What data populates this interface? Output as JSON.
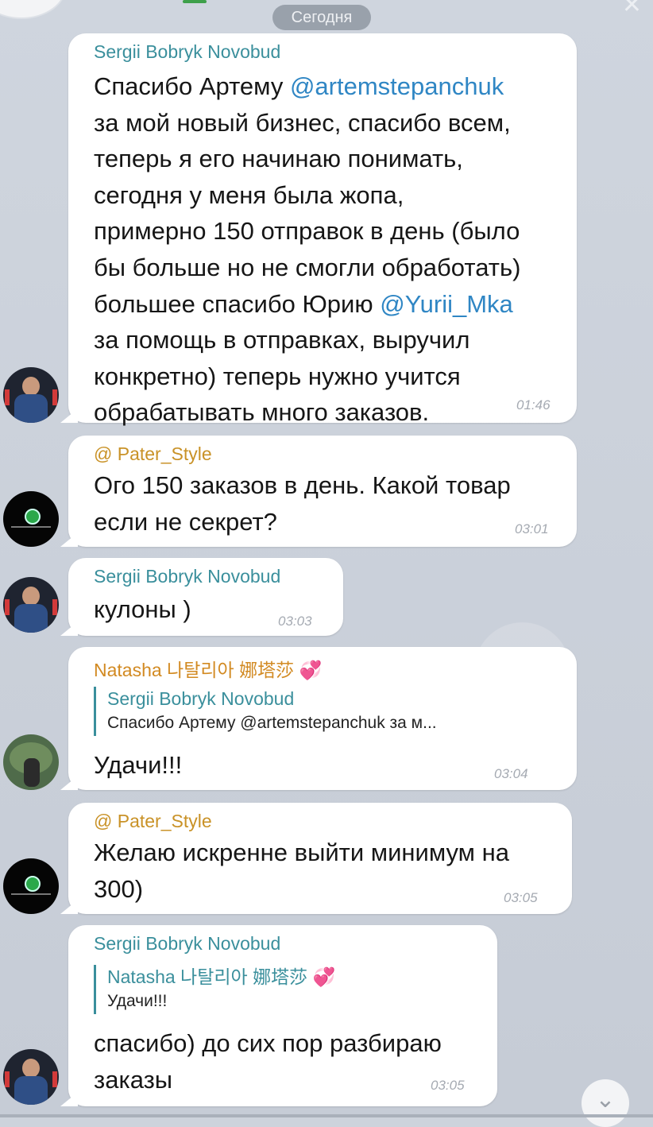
{
  "date_divider": "Сегодня",
  "messages": [
    {
      "sender": "Sergii Bobryk Novobud",
      "text_line1_pre": "Спасибо Артему ",
      "mention1": "@artemstepanchuk",
      "text_mid": "за мой новый бизнес, спасибо всем,\nтеперь я его начинаю понимать,\nсегодня у меня была жопа,\nпримерно 150 отправок в день (было\nбы больше но не смогли обработать)",
      "text_line7_pre": "большее спасибо Юрию ",
      "mention2": "@Yurii_Mka",
      "text_end": "за помощь в отправках, выручил\nконкретно) теперь нужно учится\nобрабатывать много заказов.",
      "time": "01:46"
    },
    {
      "sender": "@ Pater_Style",
      "text": "Ого 150 заказов в день.  Какой товар\nесли не секрет?",
      "time": "03:01"
    },
    {
      "sender": "Sergii Bobryk Novobud",
      "text": "кулоны )",
      "time": "03:03"
    },
    {
      "sender": "Natasha 나탈리아 娜塔莎",
      "sender_emoji": "💞",
      "reply_name": "Sergii Bobryk Novobud",
      "reply_text": "Спасибо Артему @artemstepanchuk за м...",
      "text": "Удачи!!!",
      "time": "03:04"
    },
    {
      "sender": "@ Pater_Style",
      "text": "Желаю искренне выйти минимум на\n300)",
      "time": "03:05"
    },
    {
      "sender": "Sergii Bobryk Novobud",
      "reply_name": "Natasha 나탈리아 娜塔莎",
      "reply_emoji": "💞",
      "reply_text": "Удачи!!!",
      "text": "спасибо) до сих пор разбираю\nзаказы",
      "time": "03:05"
    }
  ],
  "icons": {
    "close": "close-icon",
    "scroll_down": "chevron-down-icon",
    "scroll_down_glyph": "⌄",
    "close_glyph": "✕"
  },
  "colors": {
    "mention": "#2f86c4",
    "sender_sergii": "#3a8f9c",
    "sender_pater": "#c99227",
    "sender_natasha": "#d28a22"
  }
}
